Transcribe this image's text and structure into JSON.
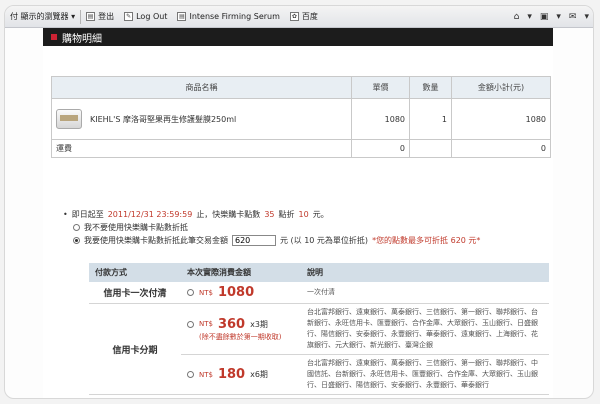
{
  "browser": {
    "favorites_label": "付 顯示的瀏覽器 ▾",
    "bookmarks": [
      {
        "label": "登出",
        "icon": "page-icon"
      },
      {
        "label": "Log Out",
        "icon": "bookmark-icon"
      },
      {
        "label": "Intense Firming Serum",
        "icon": "page-icon"
      },
      {
        "label": "百度",
        "icon": "baidu-icon"
      }
    ],
    "right_icons": [
      "⌂",
      "▾",
      "▣",
      "▾",
      "✉",
      "▾"
    ]
  },
  "cart": {
    "title": "購物明細",
    "columns": [
      "商品名稱",
      "單價",
      "數量",
      "金額小計(元)"
    ],
    "items": [
      {
        "name": "KIEHL'S 摩洛哥堅果再生修護髮膜250ml",
        "price": "1080",
        "qty": "1",
        "subtotal": "1080"
      }
    ],
    "shipping": {
      "label": "運費",
      "price": "0",
      "subtotal": "0"
    }
  },
  "points": {
    "line1_prefix": "即日起至",
    "line1_date": "2011/12/31 23:59:59",
    "line1_mid": "止，快樂購卡點數",
    "line1_points": "35",
    "line1_rate": "點折",
    "line1_amount": "10",
    "line1_suffix": "元。",
    "opt_no": "我不要使用快樂購卡點數折抵",
    "opt_yes_prefix": "我要使用快樂購卡點數折抵此筆交易金額",
    "opt_yes_value": "620",
    "opt_yes_suffix": "元 (以 10 元為單位折抵)",
    "warning": "*您的點數最多可折抵 620 元*"
  },
  "payment": {
    "headers": [
      "付款方式",
      "本次實際消費金額",
      "說明"
    ],
    "rows": [
      {
        "method": "信用卡一次付清",
        "currency": "NT$",
        "amount": "1080",
        "suffix": "",
        "note": "",
        "desc": "一次付清"
      },
      {
        "method": "信用卡分期",
        "currency": "NT$",
        "amount": "360",
        "suffix": "x3期",
        "note": "(除不盡餘數於第一期收取)",
        "desc": "台北富邦銀行、遠東銀行、萬泰銀行、三信銀行、第一銀行、聯邦銀行、台新銀行、永旺信用卡、匯豐銀行、合作金庫、大眾銀行、玉山銀行、日盛銀行、陽信銀行、安泰銀行、永豐銀行、華泰銀行、遠東銀行、上海銀行、花旗銀行、元大銀行、新光銀行、臺灣企銀"
      },
      {
        "method": "",
        "currency": "NT$",
        "amount": "180",
        "suffix": "x6期",
        "note": "",
        "desc": "台北富邦銀行、遠東銀行、萬泰銀行、三信銀行、第一銀行、聯邦銀行、中國信託、台新銀行、永旺信用卡、匯豐銀行、合作金庫、大眾銀行、玉山銀行、日盛銀行、陽信銀行、安泰銀行、永豐銀行、華泰銀行"
      }
    ]
  },
  "colors": {
    "accent_red": "#c0392b",
    "header_dark": "#1c1c1c",
    "table_header": "#d3dee7"
  }
}
